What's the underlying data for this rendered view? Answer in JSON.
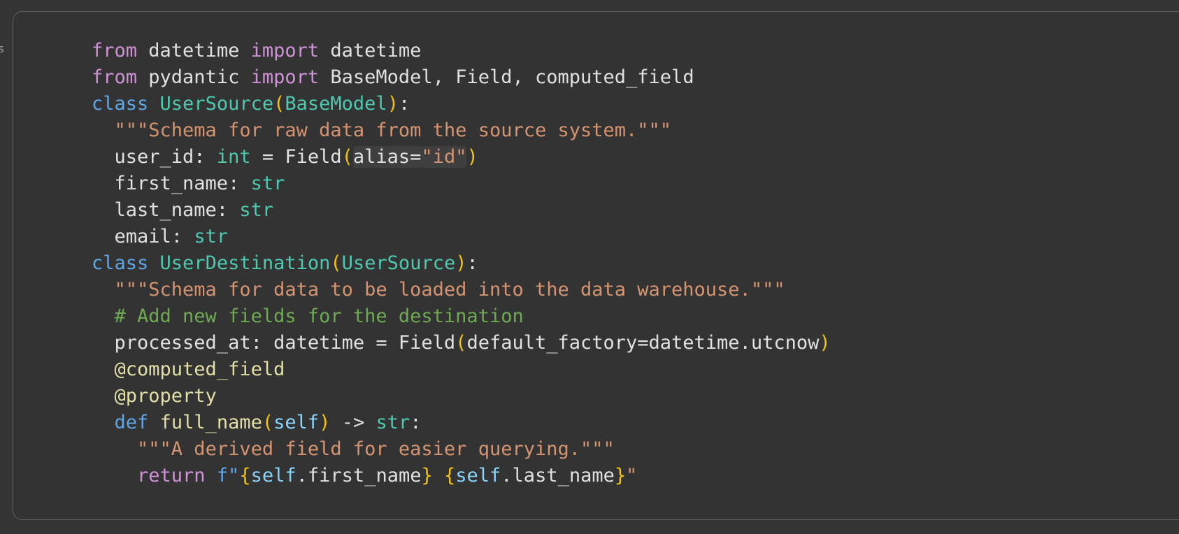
{
  "edge_fragment": "s",
  "code": {
    "lines": [
      [
        {
          "t": "from",
          "c": "kw"
        },
        {
          "t": " datetime ",
          "c": "plain"
        },
        {
          "t": "import",
          "c": "kw"
        },
        {
          "t": " datetime",
          "c": "plain"
        }
      ],
      [
        {
          "t": "from",
          "c": "kw"
        },
        {
          "t": " pydantic ",
          "c": "plain"
        },
        {
          "t": "import",
          "c": "kw"
        },
        {
          "t": " BaseModel, Field, computed_field",
          "c": "plain"
        }
      ],
      [
        {
          "t": "class",
          "c": "kw2"
        },
        {
          "t": " ",
          "c": "plain"
        },
        {
          "t": "UserSource",
          "c": "cls"
        },
        {
          "t": "(",
          "c": "br"
        },
        {
          "t": "BaseModel",
          "c": "cls"
        },
        {
          "t": ")",
          "c": "br"
        },
        {
          "t": ":",
          "c": "plain"
        }
      ],
      [
        {
          "t": "  ",
          "c": "plain"
        },
        {
          "t": "\"\"\"Schema for raw data from the source system.\"\"\"",
          "c": "str"
        }
      ],
      [
        {
          "t": "  user_id: ",
          "c": "plain"
        },
        {
          "t": "int",
          "c": "tp"
        },
        {
          "t": " = Field",
          "c": "plain"
        },
        {
          "t": "(",
          "c": "br"
        },
        {
          "t": "alias=",
          "c": "plain hl"
        },
        {
          "t": "\"id\"",
          "c": "str hl"
        },
        {
          "t": ")",
          "c": "br"
        }
      ],
      [
        {
          "t": "  first_name: ",
          "c": "plain"
        },
        {
          "t": "str",
          "c": "tp"
        }
      ],
      [
        {
          "t": "  last_name: ",
          "c": "plain"
        },
        {
          "t": "str",
          "c": "tp"
        }
      ],
      [
        {
          "t": "  email: ",
          "c": "plain"
        },
        {
          "t": "str",
          "c": "tp"
        }
      ],
      [
        {
          "t": "class",
          "c": "kw2"
        },
        {
          "t": " ",
          "c": "plain"
        },
        {
          "t": "UserDestination",
          "c": "cls"
        },
        {
          "t": "(",
          "c": "br"
        },
        {
          "t": "UserSource",
          "c": "cls"
        },
        {
          "t": ")",
          "c": "br"
        },
        {
          "t": ":",
          "c": "plain"
        }
      ],
      [
        {
          "t": "  ",
          "c": "plain"
        },
        {
          "t": "\"\"\"Schema for data to be loaded into the data warehouse.\"\"\"",
          "c": "str"
        }
      ],
      [
        {
          "t": "  ",
          "c": "plain"
        },
        {
          "t": "# Add new fields for the destination",
          "c": "cmt"
        }
      ],
      [
        {
          "t": "  processed_at: datetime = Field",
          "c": "plain"
        },
        {
          "t": "(",
          "c": "br"
        },
        {
          "t": "default_factory=datetime.utcnow",
          "c": "plain"
        },
        {
          "t": ")",
          "c": "br"
        }
      ],
      [
        {
          "t": "  ",
          "c": "plain"
        },
        {
          "t": "@computed_field",
          "c": "dec"
        }
      ],
      [
        {
          "t": "  ",
          "c": "plain"
        },
        {
          "t": "@property",
          "c": "dec"
        }
      ],
      [
        {
          "t": "  ",
          "c": "plain"
        },
        {
          "t": "def",
          "c": "kw2"
        },
        {
          "t": " ",
          "c": "plain"
        },
        {
          "t": "full_name",
          "c": "fn"
        },
        {
          "t": "(",
          "c": "br"
        },
        {
          "t": "self",
          "c": "slf"
        },
        {
          "t": ")",
          "c": "br"
        },
        {
          "t": " -> ",
          "c": "plain"
        },
        {
          "t": "str",
          "c": "tp"
        },
        {
          "t": ":",
          "c": "plain"
        }
      ],
      [
        {
          "t": "    ",
          "c": "plain"
        },
        {
          "t": "\"\"\"A derived field for easier querying.\"\"\"",
          "c": "str"
        }
      ],
      [
        {
          "t": "    ",
          "c": "plain"
        },
        {
          "t": "return",
          "c": "kw"
        },
        {
          "t": " ",
          "c": "plain"
        },
        {
          "t": "f\"",
          "c": "kw2"
        },
        {
          "t": "{",
          "c": "br"
        },
        {
          "t": "self",
          "c": "slf"
        },
        {
          "t": ".first_name",
          "c": "plain"
        },
        {
          "t": "}",
          "c": "br"
        },
        {
          "t": " ",
          "c": "str"
        },
        {
          "t": "{",
          "c": "br"
        },
        {
          "t": "self",
          "c": "slf"
        },
        {
          "t": ".last_name",
          "c": "plain"
        },
        {
          "t": "}",
          "c": "br"
        },
        {
          "t": "\"",
          "c": "str"
        }
      ]
    ]
  },
  "colors": {
    "background": "#353535",
    "keyword_import": "#cf92d6",
    "keyword_def": "#5fa6e8",
    "type": "#4ec9b0",
    "string": "#d59471",
    "comment": "#6fa953",
    "decorator": "#e3dfa6",
    "self": "#8cd3fa",
    "bracket": "#f2c40e"
  }
}
